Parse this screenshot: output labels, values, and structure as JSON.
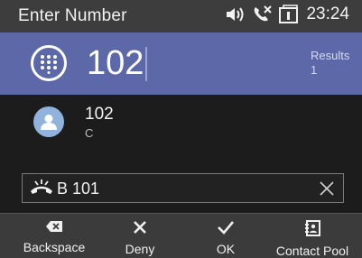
{
  "status_bar": {
    "title": "Enter Number",
    "icons": [
      "volume-icon",
      "missed-call-icon",
      "voicemail-icon"
    ],
    "time": "23:24"
  },
  "entry": {
    "icon": "dialpad-icon",
    "value": "102",
    "results_label": "Results",
    "results_count": "1"
  },
  "results": [
    {
      "name": "102",
      "sub": "C",
      "icon": "contact-avatar-icon"
    }
  ],
  "call_bar": {
    "icon": "hang-up-icon",
    "label": "B 101",
    "close_icon": "close-icon"
  },
  "softkeys": [
    {
      "label": "Backspace",
      "icon": "backspace-icon"
    },
    {
      "label": "Deny",
      "icon": "x-icon"
    },
    {
      "label": "OK",
      "icon": "check-icon"
    },
    {
      "label": "Contact Pool",
      "icon": "contact-book-icon"
    }
  ],
  "colors": {
    "status_bar_bg": "#3d3d3d",
    "entry_bg": "#5c68a8",
    "body_bg": "#1c1c1c",
    "softkey_bg": "#3b3b3b",
    "avatar": "#8fb3dd"
  }
}
